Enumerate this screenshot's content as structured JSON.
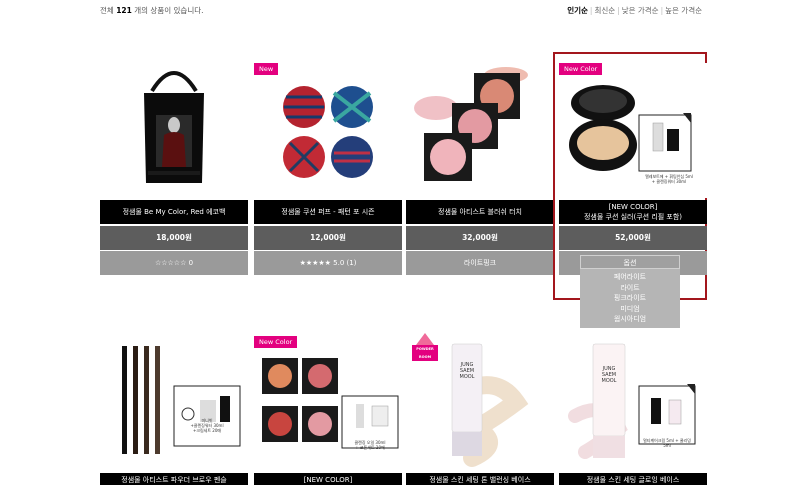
{
  "header": {
    "count_prefix": "전체",
    "count_value": "121",
    "count_suffix": "개의 상품이 있습니다.",
    "sort_options": [
      "인기순",
      "최신순",
      "낮은 가격순",
      "높은 가격순"
    ],
    "sort_active": "인기순"
  },
  "products": [
    {
      "badge": "",
      "name_lines": [
        "정샘물 Be My Color, Red 에코백"
      ],
      "price": "18,000원",
      "rating": "☆☆☆☆☆ 0"
    },
    {
      "badge": "New",
      "name_lines": [
        "정샘물 쿠션 퍼프 - 패턴 포 시즌"
      ],
      "price": "12,000원",
      "rating": "★★★★★ 5.0 (1)"
    },
    {
      "badge": "",
      "name_lines": [
        "정샘물 아티스트 블러쉬 터치"
      ],
      "price": "32,000원",
      "rating": "라이트핑크"
    },
    {
      "badge": "New Color",
      "name_lines": [
        "[NEW COLOR]",
        "정샘물 쿠션 실러(쿠션 리필 포함)"
      ],
      "price": "52,000원",
      "rating": "옵션"
    },
    {
      "badge": "",
      "name_lines": [
        "정샘물 아티스트 파우더 브로우 펜슬"
      ],
      "price": "",
      "rating": ""
    },
    {
      "badge": "New Color",
      "name_lines": [
        "[NEW COLOR]"
      ],
      "price": "",
      "rating": ""
    },
    {
      "badge": "POWDER ROOM",
      "name_lines": [
        "정샘물 스킨 세팅 톤 밸런싱 베이스"
      ],
      "price": "",
      "rating": ""
    },
    {
      "badge": "",
      "name_lines": [
        "정샘물 스킨 세팅 글로잉 베이스"
      ],
      "price": "",
      "rating": ""
    }
  ],
  "dropdown": {
    "label": "옵션",
    "options": [
      "페어라이트",
      "라이트",
      "핑크라이트",
      "미디엄",
      "웜시아디엄"
    ]
  },
  "gift_labels": {
    "p4": [
      "엘레보트에 + 휘팅안심 5ml",
      "+ 클렌징워터 30ml"
    ],
    "p5": [
      "미니빗",
      "+클렌징워터 30ml",
      "+크림세트 20매"
    ],
    "p6": [
      "클렌징 오일 30ml",
      "+ 코튼세트 20매"
    ],
    "p8": [
      "멀티케어크림 5ml + 쿨리밍 5ml"
    ]
  },
  "brand": {
    "logo_lines": [
      "JUNG",
      "SAEM",
      "MOOL"
    ]
  },
  "colors": {
    "badge": "#e3007f",
    "highlight": "#a3161d",
    "name_bar": "#000000",
    "price_bar": "#5d5d5d",
    "rating_bar": "#9a9a9a"
  }
}
